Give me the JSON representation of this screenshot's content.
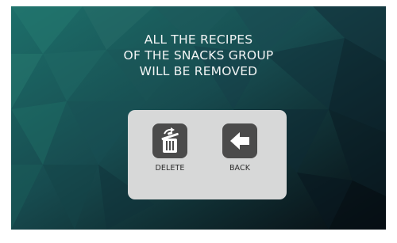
{
  "dialog": {
    "message_lines": [
      "ALL THE RECIPES",
      "OF THE SNACKS GROUP",
      "WILL BE REMOVED"
    ],
    "buttons": {
      "delete": {
        "label": "DELETE",
        "icon": "trash-icon"
      },
      "back": {
        "label": "BACK",
        "icon": "back-arrow-icon"
      }
    }
  },
  "colors": {
    "background_teal": "#1f6a66",
    "background_dark": "#0a0f14",
    "dialog_panel": "#d7d8d8",
    "button_bg": "#4b4b4b",
    "text_light": "#f2f4f4"
  }
}
